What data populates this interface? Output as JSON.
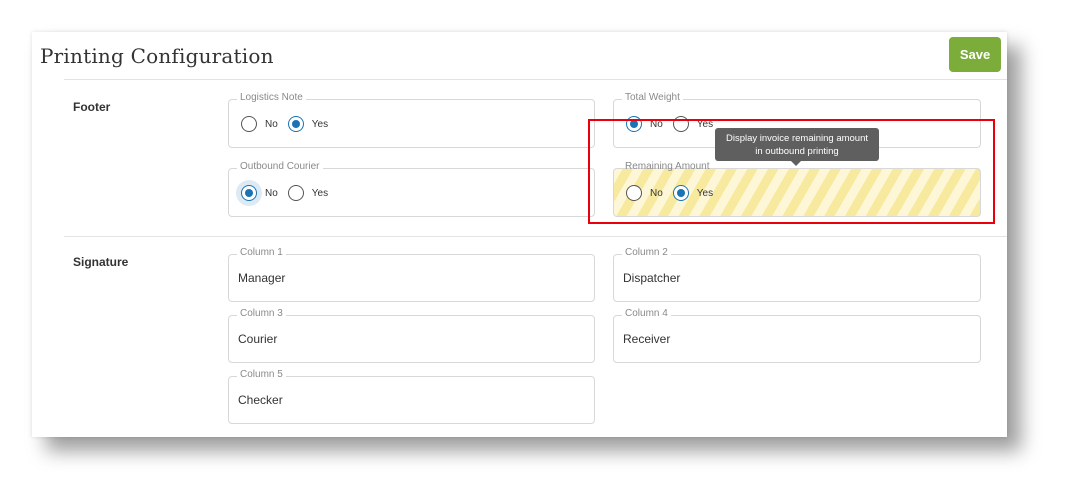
{
  "header": {
    "title": "Printing Configuration",
    "save_label": "Save"
  },
  "footer": {
    "label": "Footer",
    "logistics_note": {
      "legend": "Logistics Note",
      "no": "No",
      "yes": "Yes",
      "selected": "Yes"
    },
    "total_weight": {
      "legend": "Total Weight",
      "no": "No",
      "yes": "Yes",
      "selected": "No"
    },
    "outbound_courier": {
      "legend": "Outbound Courier",
      "no": "No",
      "yes": "Yes",
      "selected": "No"
    },
    "remaining_amount": {
      "legend": "Remaining Amount",
      "no": "No",
      "yes": "Yes",
      "selected": "Yes"
    }
  },
  "tooltip": {
    "line1": "Display invoice remaining amount",
    "line2": "in outbound printing"
  },
  "signature": {
    "label": "Signature",
    "columns": [
      {
        "legend": "Column 1",
        "value": "Manager"
      },
      {
        "legend": "Column 2",
        "value": "Dispatcher"
      },
      {
        "legend": "Column 3",
        "value": "Courier"
      },
      {
        "legend": "Column 4",
        "value": "Receiver"
      },
      {
        "legend": "Column 5",
        "value": "Checker"
      }
    ]
  },
  "colors": {
    "accent": "#1a73b5",
    "save": "#7cad3a",
    "highlight": "#e8000b",
    "tooltip": "#5f5f5f"
  }
}
